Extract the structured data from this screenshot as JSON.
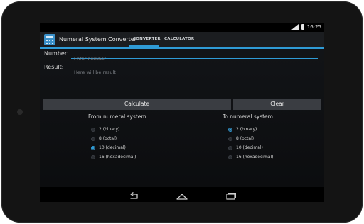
{
  "status_bar": {
    "time": "16:25"
  },
  "app": {
    "title": "Numeral System Converter",
    "tabs": [
      {
        "label": "CONVERTER",
        "selected": true
      },
      {
        "label": "CALCULATOR",
        "selected": false
      }
    ],
    "accent_color": "#2f9bd6"
  },
  "form": {
    "number": {
      "label": "Number:",
      "placeholder": "Enter number"
    },
    "result": {
      "label": "Result:",
      "placeholder": "Here will be result"
    }
  },
  "buttons": {
    "calculate": "Calculate",
    "clear": "Clear"
  },
  "from_system": {
    "title": "From numeral system:",
    "options": [
      "2 (binary)",
      "8 (octal)",
      "10 (decimal)",
      "16 (hexadecimal)"
    ],
    "selected": "10 (decimal)"
  },
  "to_system": {
    "title": "To numeral system:",
    "options": [
      "2 (binary)",
      "8 (octal)",
      "10 (decimal)",
      "16 (hexadecimal)"
    ],
    "selected": "2 (binary)"
  },
  "nav_icons": [
    "back-icon",
    "home-icon",
    "recents-icon"
  ]
}
